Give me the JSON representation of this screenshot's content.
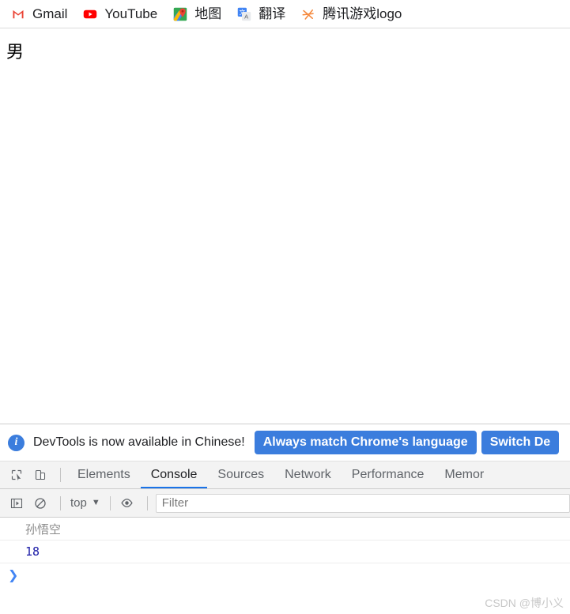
{
  "bookmarks_bar": {
    "items": [
      {
        "label": "Gmail",
        "icon": "gmail-icon"
      },
      {
        "label": "YouTube",
        "icon": "youtube-icon"
      },
      {
        "label": "地图",
        "icon": "google-maps-icon"
      },
      {
        "label": "翻译",
        "icon": "google-translate-icon"
      },
      {
        "label": "腾讯游戏logo",
        "icon": "tencent-games-icon"
      }
    ]
  },
  "page": {
    "body_text": "男"
  },
  "devtools": {
    "banner": {
      "icon": "info-icon",
      "message": "DevTools is now available in Chinese!",
      "primary_button": "Always match Chrome's language",
      "secondary_button": "Switch De"
    },
    "tabs": [
      {
        "label": "Elements",
        "active": false
      },
      {
        "label": "Console",
        "active": true
      },
      {
        "label": "Sources",
        "active": false
      },
      {
        "label": "Network",
        "active": false
      },
      {
        "label": "Performance",
        "active": false
      },
      {
        "label": "Memor",
        "active": false
      }
    ],
    "toolbar_icons": {
      "inspect": "inspect-element-icon",
      "device": "device-toolbar-icon"
    },
    "console_toolbar": {
      "execute_icon": "console-sidebar-icon",
      "clear_icon": "clear-console-icon",
      "context": "top",
      "context_caret": "▼",
      "eye_icon": "live-expression-icon",
      "filter_placeholder": "Filter",
      "filter_value": ""
    },
    "console_logs": [
      {
        "text": "孙悟空",
        "type": "string"
      },
      {
        "text": "18",
        "type": "number"
      }
    ],
    "prompt_caret": "❯"
  },
  "watermark": {
    "text": "CSDN @博小义"
  },
  "colors": {
    "accent_blue": "#3b7ddd",
    "tab_active_underline": "#1a73e8",
    "number_color": "#1a1aa6",
    "string_color": "#8a8a8a",
    "watermark_color": "#c8c8c8"
  }
}
